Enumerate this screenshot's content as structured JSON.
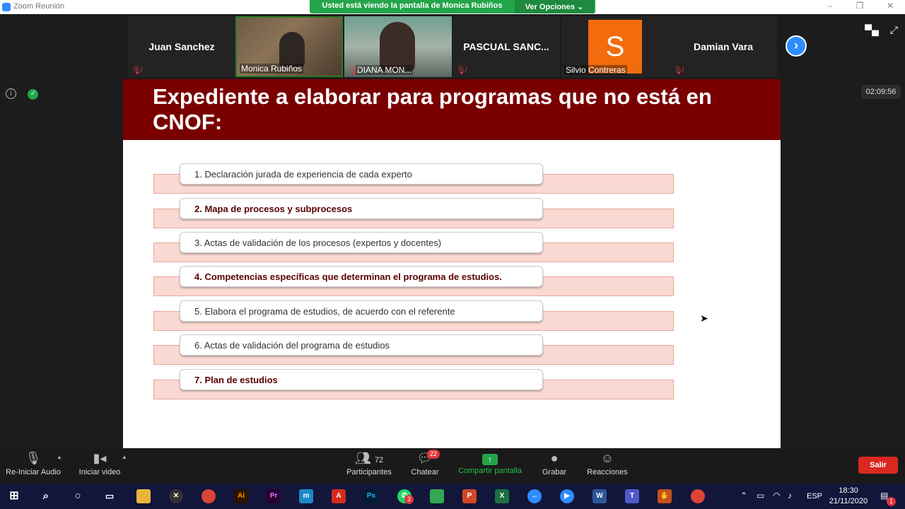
{
  "window": {
    "title": "Zoom Reunión"
  },
  "banner": {
    "message": "Usted está viendo la pantalla de Monica Rubiños",
    "options_label": "Ver Opciones"
  },
  "participants": [
    {
      "name": "Juan Sanchez",
      "type": "name"
    },
    {
      "name": "Monica Rubiños",
      "type": "video"
    },
    {
      "name": "DIANA MON...",
      "type": "video"
    },
    {
      "name": "PASCUAL  SANC...",
      "type": "name"
    },
    {
      "name": "Silvio Contreras",
      "type": "avatar",
      "initial": "S"
    },
    {
      "name": "Damian Vara",
      "type": "name"
    }
  ],
  "meeting": {
    "timer": "02:09:56"
  },
  "slide": {
    "title": "Expediente a elaborar para programas que no está en CNOF:",
    "items": [
      {
        "text": "1. Declaración jurada de experiencia de cada experto",
        "bold": false
      },
      {
        "text": "2. Mapa de procesos y subprocesos",
        "bold": true
      },
      {
        "text": "3. Actas de validación de los procesos (expertos y docentes)",
        "bold": false
      },
      {
        "text": "4. Competencias específicas que determinan el programa de estudios.",
        "bold": true
      },
      {
        "text": "5. Elabora el programa de estudios, de acuerdo con el referente",
        "bold": false
      },
      {
        "text": "6. Actas de validación del programa de estudios",
        "bold": false
      },
      {
        "text": "7. Plan de estudios",
        "bold": true
      }
    ]
  },
  "toolbar": {
    "audio_label": "Re-Iniciar Audio",
    "video_label": "Iniciar video",
    "participants_label": "Participantes",
    "participants_count": "72",
    "chat_label": "Chatear",
    "chat_badge": "22",
    "share_label": "Compartir pantalla",
    "record_label": "Grabar",
    "reactions_label": "Reacciones",
    "leave_label": "Salir"
  },
  "taskbar": {
    "language": "ESP",
    "time": "18:30",
    "date": "21/11/2020",
    "whatsapp_badge": "3",
    "notification_badge": "1"
  },
  "colors": {
    "slide_header": "#7a0000",
    "item_band": "#fad9d2",
    "zoom_blue": "#2d8cff",
    "share_green": "#23a54a",
    "leave_red": "#d9281f"
  }
}
